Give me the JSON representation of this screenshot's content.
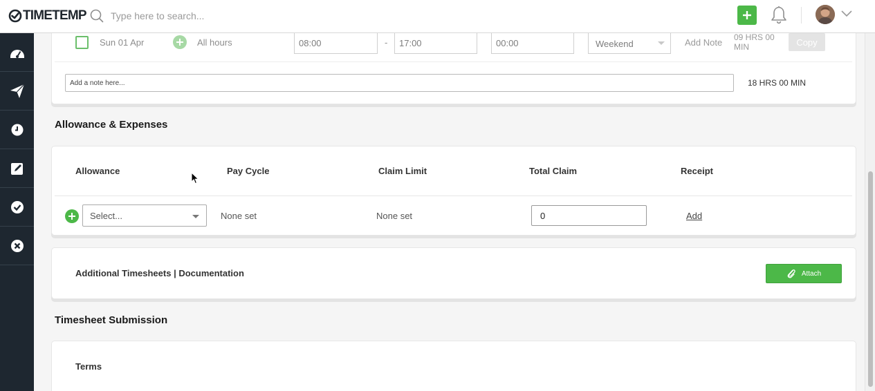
{
  "app": {
    "logo_text": "TIMETEMP",
    "search_placeholder": "Type here to search..."
  },
  "timesheet_row": {
    "date": "Sun 01 Apr",
    "all_hours_label": "All hours",
    "start_time": "08:00",
    "separator": "-",
    "end_time": "17:00",
    "break_time": "00:00",
    "day_type": "Weekend",
    "add_note_label": "Add Note",
    "hours": "09 HRS 00 MIN",
    "copy_label": "Copy"
  },
  "note": {
    "placeholder": "Add a note here...",
    "total_hours": "18 HRS 00 MIN"
  },
  "allowance": {
    "section_title": "Allowance & Expenses",
    "headers": [
      "Allowance",
      "Pay Cycle",
      "Claim Limit",
      "Total Claim",
      "Receipt"
    ],
    "row": {
      "select_value": "Select...",
      "pay_cycle": "None set",
      "claim_limit": "None set",
      "total_claim": "0",
      "receipt_action": "Add"
    }
  },
  "additional": {
    "label": "Additional Timesheets | Documentation",
    "attach_label": "Attach"
  },
  "submission": {
    "section_title": "Timesheet Submission",
    "terms_label": "Terms"
  },
  "sidebar": {
    "items": [
      {
        "icon": "dashboard-icon"
      },
      {
        "icon": "send-icon"
      },
      {
        "icon": "clock-icon"
      },
      {
        "icon": "edit-icon"
      },
      {
        "icon": "check-circle-icon"
      },
      {
        "icon": "close-circle-icon"
      }
    ]
  },
  "colors": {
    "accent_green": "#4cb848",
    "sidebar_bg": "#1e2730"
  }
}
